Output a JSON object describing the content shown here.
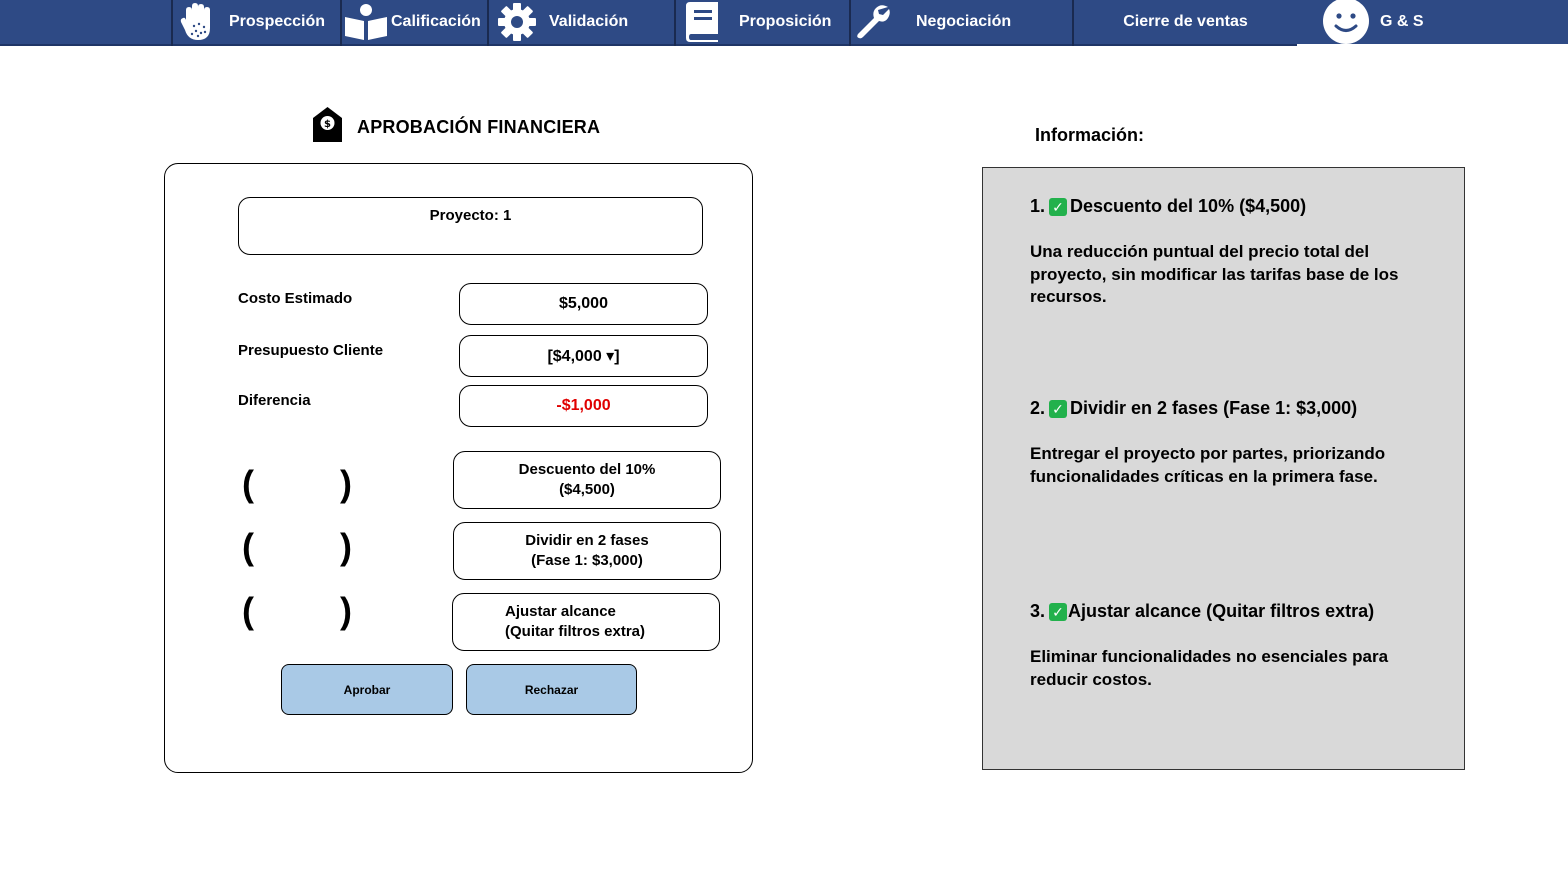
{
  "nav": {
    "items": [
      {
        "label": "Prospección",
        "icon": "hand-icon"
      },
      {
        "label": "Calificación",
        "icon": "book-reader-icon"
      },
      {
        "label": "Validación",
        "icon": "gear-icon"
      },
      {
        "label": "Proposición",
        "icon": "book-icon"
      },
      {
        "label": "Negociación",
        "icon": "wrench-icon"
      },
      {
        "label": "Cierre de ventas",
        "icon": ""
      }
    ],
    "user": {
      "label": "G & S",
      "icon": "smiley-avatar-icon"
    }
  },
  "approval": {
    "title": "APROBACIÓN FINANCIERA",
    "icon": "money-tag-icon",
    "project": "Proyecto: 1",
    "rows": [
      {
        "label": "Costo Estimado",
        "value": "$5,000"
      },
      {
        "label": "Presupuesto Cliente",
        "value": "[$4,000 ▾]"
      },
      {
        "label": "Diferencia",
        "value": "-$1,000",
        "color": "#e00000"
      }
    ],
    "options": [
      {
        "paren_open": "(",
        "paren_close": ")",
        "line1": "Descuento del 10%",
        "line2": "($4,500)"
      },
      {
        "paren_open": "(",
        "paren_close": ")",
        "line1": "Dividir en 2 fases",
        "line2": "(Fase 1: $3,000)"
      },
      {
        "paren_open": "(",
        "paren_close": ")",
        "line1": "Ajustar alcance",
        "line2": "(Quitar filtros extra)"
      }
    ],
    "approve_label": "Aprobar",
    "reject_label": "Rechazar",
    "button_color": "#a9c9e6"
  },
  "info": {
    "title": "Información:",
    "items": [
      {
        "num": "1.",
        "check": "✓",
        "heading": "Descuento del 10% ($4,500)",
        "text": "Una reducción puntual del precio total del proyecto, sin modificar las tarifas base de los recursos."
      },
      {
        "num": "2.",
        "check": "✓",
        "heading": "Dividir en 2 fases (Fase 1: $3,000)",
        "text": "Entregar el proyecto por partes, priorizando funcionalidades críticas en la primera fase."
      },
      {
        "num": "3.",
        "check": "✓",
        "heading": "Ajustar alcance (Quitar filtros extra)",
        "text": "Eliminar funcionalidades no esenciales para reducir costos."
      }
    ]
  },
  "colors": {
    "nav": "#2e4a85",
    "panel": "#d9d9d9",
    "check": "#22b14c",
    "negative": "#e00000"
  }
}
